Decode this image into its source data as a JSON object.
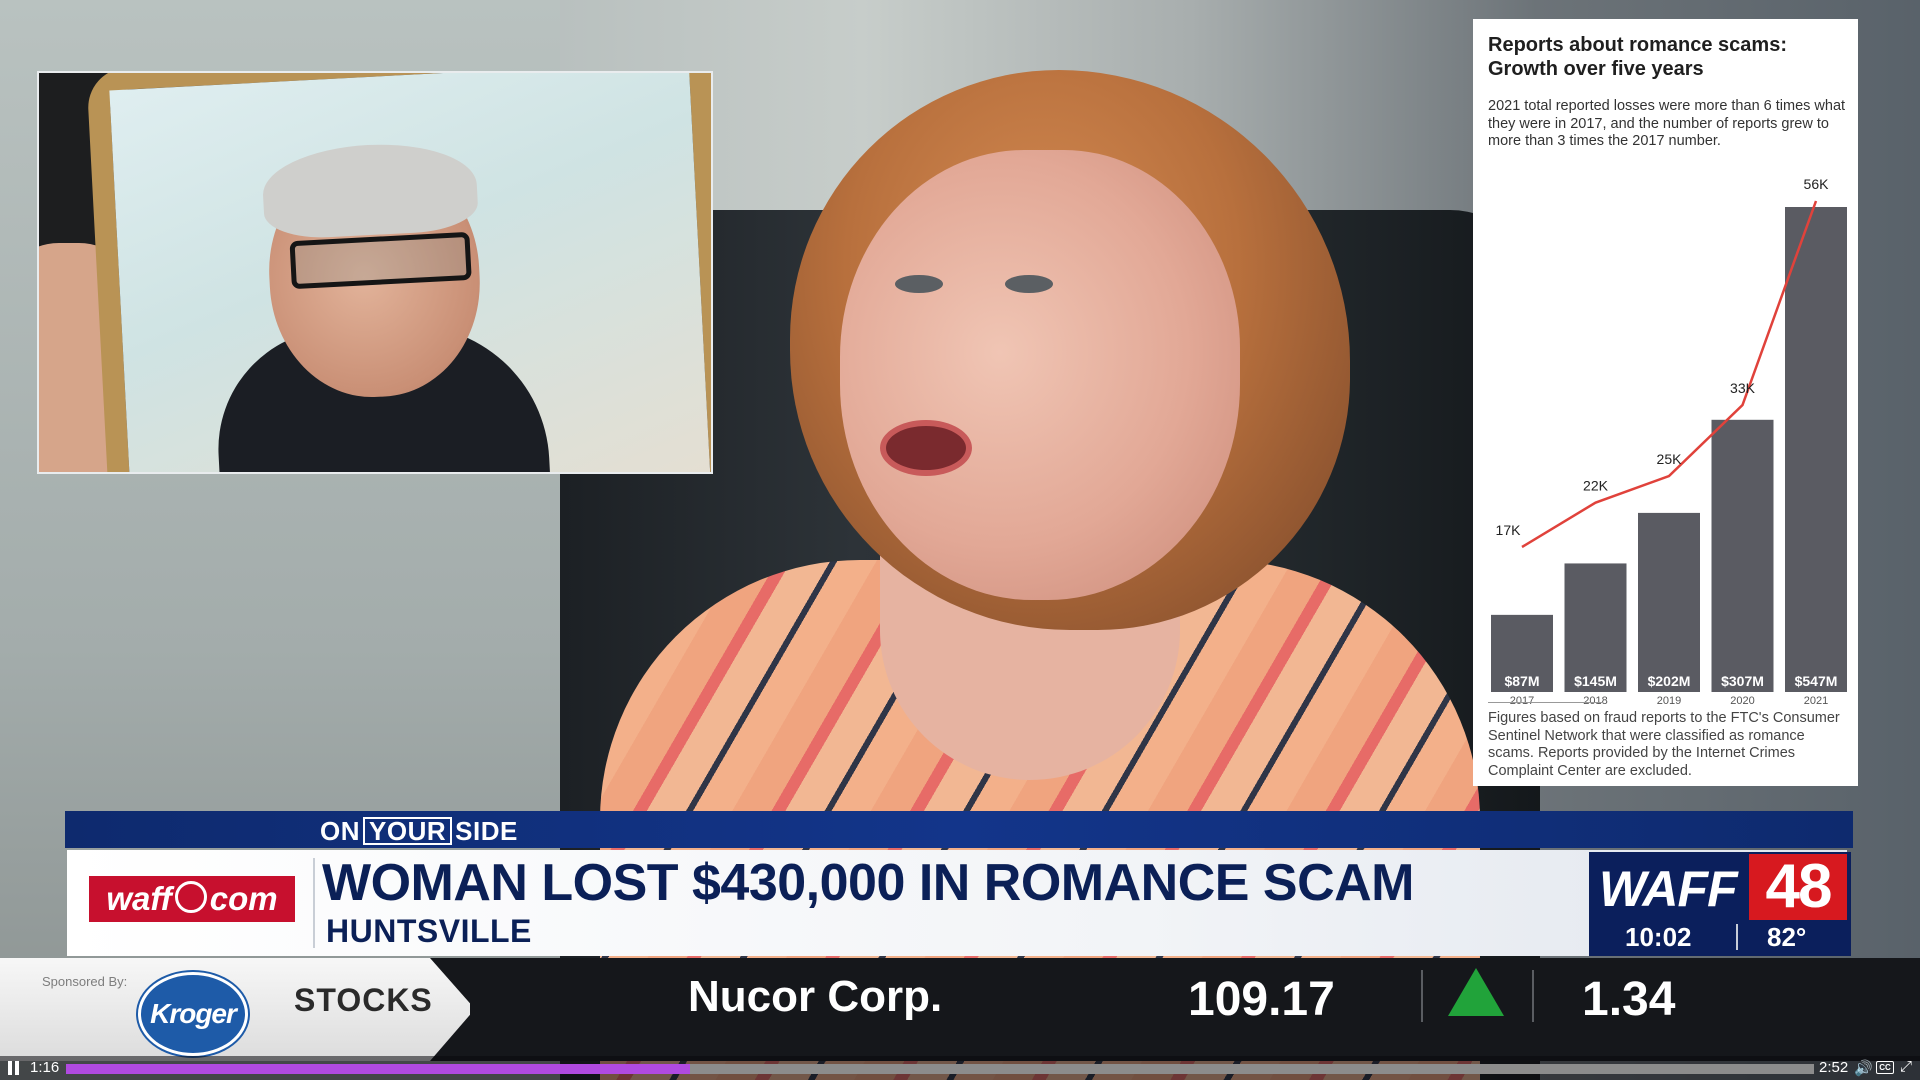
{
  "infographic": {
    "title": "Reports about romance scams: Growth over five years",
    "subtitle": "2021 total reported losses were more than 6 times what they were in 2017, and the number of reports grew to more than 3 times the 2017 number.",
    "footnote": "Figures based on fraud reports to the FTC's Consumer Sentinel Network that were classified as romance scams. Reports provided by the Internet Crimes Complaint Center are excluded."
  },
  "chart_data": {
    "type": "bar",
    "title": "Reports about romance scams: Growth over five years",
    "categories": [
      "2017",
      "2018",
      "2019",
      "2020",
      "2021"
    ],
    "series": [
      {
        "values": [
          87,
          145,
          202,
          307,
          547
        ],
        "labels": [
          "$87M",
          "$145M",
          "$202M",
          "$307M",
          "$547M"
        ],
        "color": "#5a5b62"
      },
      {
        "type": "line",
        "values": [
          17,
          22,
          25,
          33,
          56
        ],
        "labels": [
          "17K",
          "22K",
          "25K",
          "33K",
          "56K"
        ],
        "color": "#e0423b"
      }
    ],
    "ylim": [
      0,
      547
    ],
    "grid": false,
    "legend": "none"
  },
  "lower_third": {
    "segment": {
      "pre": "ON",
      "boxed": "YOUR",
      "post": "SIDE"
    },
    "site_logo": {
      "left": "waff",
      "right": "com"
    },
    "headline": "WOMAN LOST $430,000 IN ROMANCE SCAM",
    "location": "HUNTSVILLE"
  },
  "station": {
    "name": "WAFF",
    "channel": "48",
    "time": "10:02",
    "temperature": "82°"
  },
  "ticker": {
    "sponsored_label": "Sponsored By:",
    "sponsor": "Kroger",
    "category": "STOCKS",
    "company": "Nucor Corp.",
    "price": "109.17",
    "change": "1.34",
    "direction": "up",
    "up_color": "#21a33a"
  },
  "player": {
    "current_time": "1:16",
    "duration": "2:52",
    "progress": 0.357,
    "cc_label": "CC"
  },
  "icons": [
    "pause-icon",
    "volume-icon",
    "captions-icon",
    "fullscreen-icon",
    "up-arrow-icon"
  ]
}
